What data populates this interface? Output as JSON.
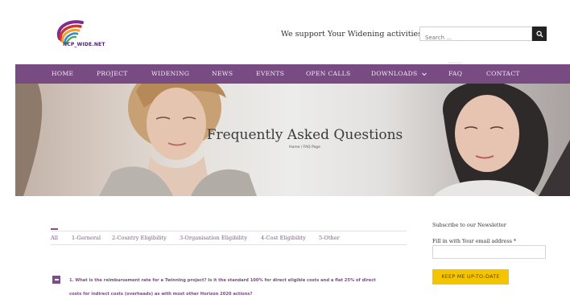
{
  "header": {
    "logo_text": "NCP_WIDE.NET",
    "tagline": "We support Your Widening activities",
    "search_placeholder": "Search ...",
    "search_icon": "search-icon"
  },
  "nav": {
    "items": [
      {
        "label": "HOME"
      },
      {
        "label": "PROJECT"
      },
      {
        "label": "WIDENING"
      },
      {
        "label": "NEWS"
      },
      {
        "label": "EVENTS"
      },
      {
        "label": "OPEN CALLS"
      },
      {
        "label": "DOWNLOADS"
      },
      {
        "label": "FAQ"
      },
      {
        "label": "CONTACT"
      }
    ],
    "active": "FAQ",
    "dropdown_icon": "chevron-down-icon"
  },
  "hero": {
    "title": "Frequently Asked Questions",
    "breadcrumb": "Home / FAQ Page"
  },
  "faq": {
    "tabs": [
      "All",
      "1-Gerneral",
      "2-Country Eligibility",
      "3-Organisation Eligibility",
      "4-Cost Eligibility",
      "5-Other"
    ],
    "active_tab": "All",
    "questions": [
      {
        "line1": "1. What is the reimbursement rate for a Twinning project? Is it the standard 100% for direct eligible costs and a flat 25% of direct",
        "line2": "costs for indirect costs (overheads) as with most other Horizon 2020 actions?",
        "expanded": true
      }
    ]
  },
  "sidebar": {
    "title": "Subscribe to our Newsletter",
    "email_label": "Fill in with Your email address *",
    "button_label": "KEEP ME UP-TO-DATE"
  },
  "colors": {
    "nav_bg": "#784b83",
    "accent": "#7e4c8a",
    "button": "#f5c400"
  }
}
